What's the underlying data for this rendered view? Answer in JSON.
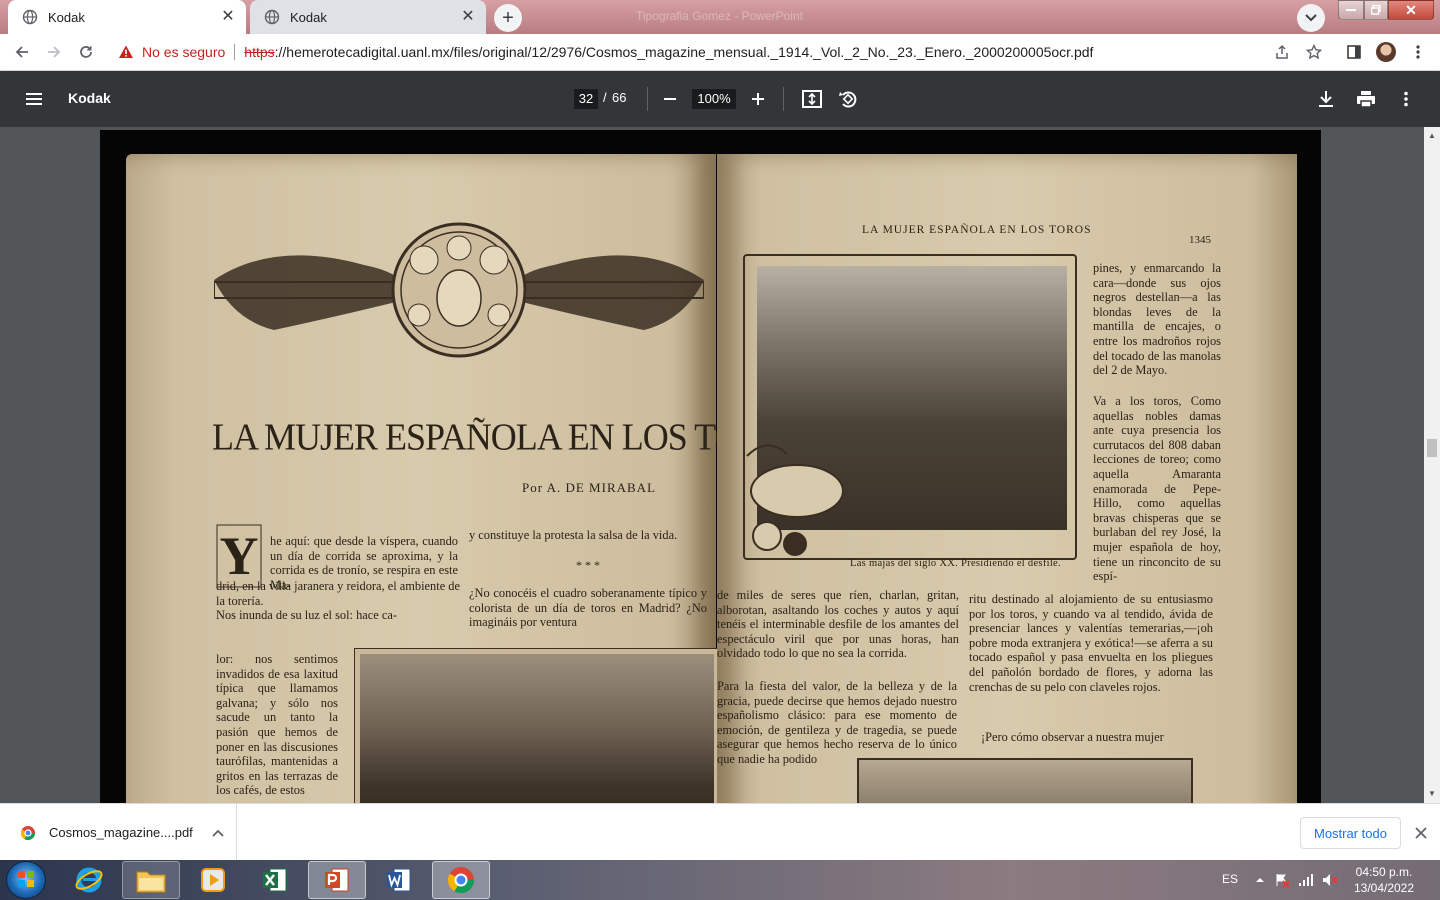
{
  "browser": {
    "tabs": [
      {
        "title": "Kodak",
        "active": true
      },
      {
        "title": "Kodak",
        "active": false
      }
    ],
    "window_ghost_title": "Tipografia Gomez - PowerPoint",
    "security_label": "No es seguro",
    "url_scheme": "https",
    "url_rest": "://hemerotecadigital.uanl.mx/files/original/12/2976/Cosmos_magazine_mensual._1914._Vol._2_No._23._Enero._2000200005ocr.pdf"
  },
  "pdf_viewer": {
    "title": "Kodak",
    "current_page": "32",
    "page_separator": "/",
    "total_pages": "66",
    "zoom": "100%"
  },
  "document": {
    "left_page": {
      "headline": "LA MUJER ESPAÑOLA EN LOS TOROS",
      "byline": "Por A. DE MIRABAL",
      "dropcap": "Y",
      "col1_intro": "he aquí: que desde la víspera, cuando un día de corrida se aproxima, y la corrida es de tronío, se respira en este Ma-",
      "col1_body": "drid, en la villa jaranera y reidora, el ambiente de la torería.\n   Nos inunda de su luz el sol: hace ca-",
      "col1_narrow": "lor: nos sentimos invadidos de esa laxitud típica que llamamos galvana; y sólo nos sacude un tanto la pasión que hemos de poner en las discusiones taurófilas, mantenidas a gritos en las terrazas de los cafés, de estos",
      "col2_top": "y constituye la protesta la salsa de la vida.",
      "stars": "* * *",
      "col2_body": "¿No conocéis el cuadro soberanamente típico y colorista de un día de toros en Madrid? ¿No imagináis por ventura"
    },
    "right_page": {
      "running_head": "LA MUJER ESPAÑOLA EN LOS TOROS",
      "page_number": "1345",
      "caption": "Las majas del siglo XX. Presidiendo el desfile.",
      "col3_top": "pines, y enmarcando la cara—donde sus ojos negros destellan—a las blondas leves de la mantilla de encajes, o entre los madroños rojos del tocado de las manolas del 2 de Mayo.",
      "col3_mid": "   Va a los toros, Como aquellas nobles damas ante cuya presencia los currutacos del 808 daban lecciones de toreo; como aquella Amaranta enamorada de Pepe-Hillo, como aquellas bravas chisperas que se burlaban del rey José, la mujer española de hoy, tiene un rinconcito de su espí-",
      "col_left_a": "de miles de seres que ríen, charlan, gritan, alborotan, asaltando los coches y autos y aquí tenéis el interminable desfile de los amantes del espectáculo viril que por unas horas, han olvidado todo lo que no sea la corrida.",
      "col_left_b": "   Para la fiesta del valor, de la belleza y de la gracia, puede decirse que hemos dejado nuestro españolismo clásico: para ese momento de emoción, de gentileza y de tragedia, se puede asegurar que hemos hecho reserva de lo único que nadie ha podido",
      "col4_top": "ritu destinado al alojamiento de su entusiasmo por los toros, y cuando va al tendido, ávida de presenciar lances y valentías temerarias,—¡oh pobre moda extranjera y exótica!—se aferra a su tocado español y pasa envuelta en los pliegues del pañolón bordado de flores, y adorna las crenchas de su pelo con claveles rojos.",
      "col4_bottom": "   ¡Pero cómo observar a nuestra mujer"
    }
  },
  "downloads": {
    "file_name": "Cosmos_magazine....pdf",
    "show_all": "Mostrar todo"
  },
  "taskbar": {
    "language": "ES",
    "time": "04:50 p.m.",
    "date": "13/04/2022",
    "apps": [
      "start-menu",
      "internet-explorer",
      "file-explorer",
      "media-player",
      "excel",
      "powerpoint",
      "word",
      "chrome"
    ]
  },
  "colors": {
    "pdf_toolbar": "#323639",
    "viewer_bg": "#525659",
    "insecure_red": "#c5221f",
    "link_blue": "#1a73e8"
  }
}
